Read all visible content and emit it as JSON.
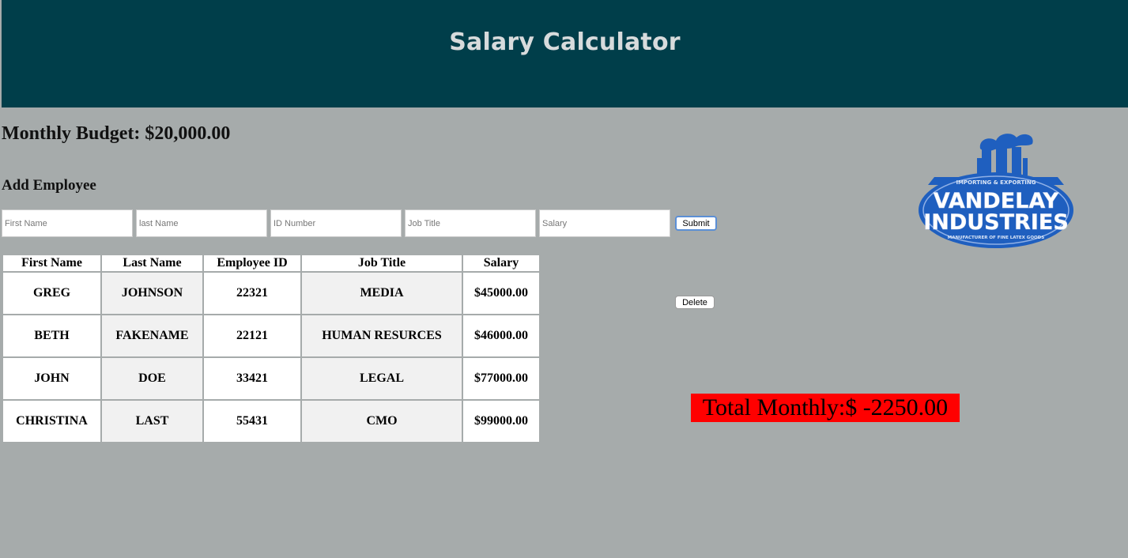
{
  "header": {
    "title": "Salary Calculator",
    "bg_color": "#003e4a",
    "title_color": "#d7dbdc"
  },
  "budget": {
    "text": "Monthly Budget: $20,000.00"
  },
  "add_employee": {
    "title": "Add Employee",
    "fields": [
      {
        "placeholder": "First Name",
        "value": ""
      },
      {
        "placeholder": "last Name",
        "value": ""
      },
      {
        "placeholder": "ID Number",
        "value": ""
      },
      {
        "placeholder": "Job Title",
        "value": ""
      },
      {
        "placeholder": "Salary",
        "value": ""
      }
    ],
    "submit_label": "Submit"
  },
  "table": {
    "headers": [
      "First Name",
      "Last Name",
      "Employee ID",
      "Job Title",
      "Salary"
    ],
    "rows": [
      [
        "GREG",
        "JOHNSON",
        "22321",
        "MEDIA",
        "$45000.00"
      ],
      [
        "BETH",
        "FAKENAME",
        "22121",
        "HUMAN RESURCES",
        "$46000.00"
      ],
      [
        "JOHN",
        "DOE",
        "33421",
        "LEGAL",
        "$77000.00"
      ],
      [
        "CHRISTINA",
        "LAST",
        "55431",
        "CMO",
        "$99000.00"
      ]
    ]
  },
  "delete_label": "Delete",
  "logo": {
    "top_text": "IMPORTING & EXPORTING",
    "line1": "VANDELAY",
    "line2": "INDUSTRIES",
    "bottom_text": "MANUFACTURER OF FINE LATEX GOODS",
    "color": "#1f5fbf"
  },
  "total": {
    "text": "Total Monthly:$ -2250.00",
    "bg_color": "#ff0000"
  },
  "colors": {
    "page_bg": "#a6abab"
  }
}
